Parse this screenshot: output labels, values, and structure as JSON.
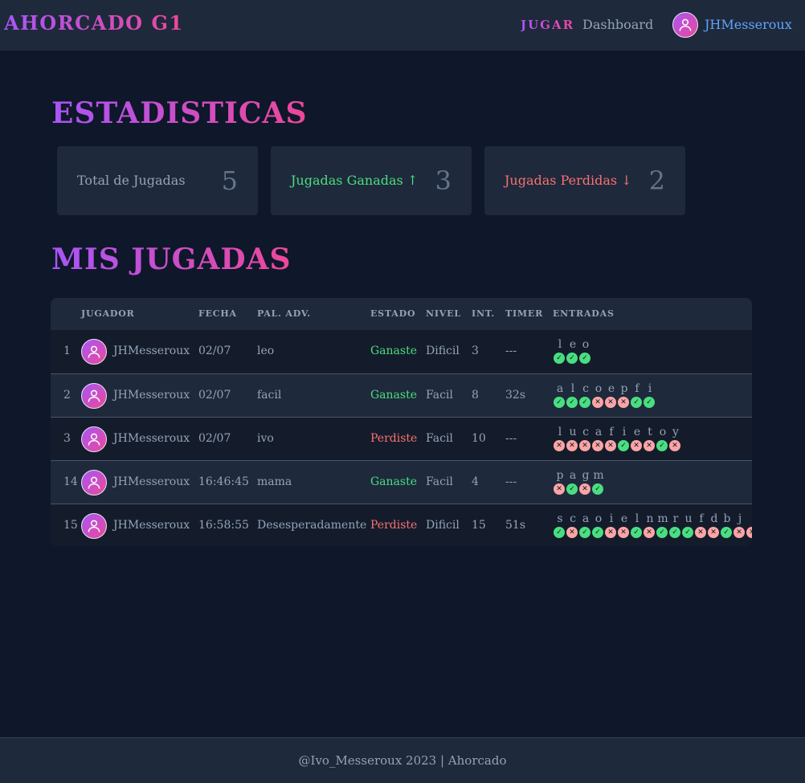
{
  "header": {
    "brand": "AHORCADO G1",
    "nav_jugar": "JUGAR",
    "nav_dashboard": "Dashboard",
    "username": "JHMesseroux"
  },
  "stats": {
    "title": "ESTADISTICAS",
    "cards": [
      {
        "label": "Total de Jugadas",
        "value": "5"
      },
      {
        "label": "Jugadas Ganadas ↑",
        "value": "3"
      },
      {
        "label": "Jugadas Perdidas ↓",
        "value": "2"
      }
    ]
  },
  "plays": {
    "title": "MIS JUGADAS",
    "columns": [
      "JUGADOR",
      "FECHA",
      "PAL. ADV.",
      "ESTADO",
      "NIVEL",
      "INT.",
      "TIMER",
      "ENTRADAS"
    ],
    "rows": [
      {
        "id": "1",
        "player": "JHMesseroux",
        "date": "02/07",
        "word": "leo",
        "status": "Ganaste",
        "won": true,
        "level": "Dificil",
        "attempts": "3",
        "timer": "---",
        "entries": [
          "l",
          "e",
          "o"
        ],
        "results": [
          1,
          1,
          1
        ]
      },
      {
        "id": "2",
        "player": "JHMesseroux",
        "date": "02/07",
        "word": "facil",
        "status": "Ganaste",
        "won": true,
        "level": "Facil",
        "attempts": "8",
        "timer": "32s",
        "entries": [
          "a",
          "l",
          "c",
          "o",
          "e",
          "p",
          "f",
          "i"
        ],
        "results": [
          1,
          1,
          1,
          0,
          0,
          0,
          1,
          1
        ]
      },
      {
        "id": "3",
        "player": "JHMesseroux",
        "date": "02/07",
        "word": "ivo",
        "status": "Perdiste",
        "won": false,
        "level": "Facil",
        "attempts": "10",
        "timer": "---",
        "entries": [
          "l",
          "u",
          "c",
          "a",
          "f",
          "i",
          "e",
          "t",
          "o",
          "y"
        ],
        "results": [
          0,
          0,
          0,
          0,
          0,
          1,
          0,
          0,
          1,
          0
        ]
      },
      {
        "id": "14",
        "player": "JHMesseroux",
        "date": "16:46:45",
        "word": "mama",
        "status": "Ganaste",
        "won": true,
        "level": "Facil",
        "attempts": "4",
        "timer": "---",
        "entries": [
          "p",
          "a",
          "g",
          "m"
        ],
        "results": [
          0,
          1,
          0,
          1
        ]
      },
      {
        "id": "15",
        "player": "JHMesseroux",
        "date": "16:58:55",
        "word": "Desesperadamente",
        "status": "Perdiste",
        "won": false,
        "level": "Dificil",
        "attempts": "15",
        "timer": "51s",
        "entries": [
          "s",
          "c",
          "a",
          "o",
          "i",
          "e",
          "l",
          "n",
          "m",
          "r",
          "u",
          "f",
          "d",
          "b",
          "j"
        ],
        "results": [
          1,
          0,
          1,
          1,
          0,
          0,
          1,
          0,
          1,
          1,
          1,
          0,
          0,
          1,
          0,
          0
        ]
      }
    ]
  },
  "footer": {
    "text": "@Ivo_Messeroux 2023 | Ahorcado"
  },
  "colors": {
    "accent_from": "#a855f7",
    "accent_to": "#ec4899",
    "won": "#4ade80",
    "lost": "#f87171",
    "username": "#60a5fa"
  }
}
